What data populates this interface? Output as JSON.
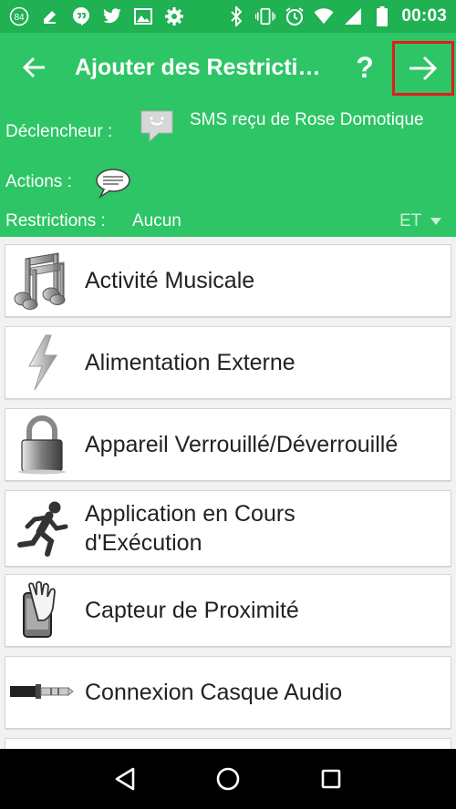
{
  "status_bar": {
    "notification_badge": "84",
    "time": "00:03",
    "icons_left": [
      "notification-84-icon",
      "hangouts-icon",
      "twitter-icon",
      "image-icon",
      "settings-icon"
    ],
    "icons_right": [
      "bluetooth-icon",
      "vibrate-icon",
      "alarm-icon",
      "wifi-icon",
      "signal-icon",
      "battery-icon"
    ]
  },
  "app_bar": {
    "title": "Ajouter des Restricti…",
    "help_label": "?",
    "background": "#2dc565",
    "highlight_color": "#e01d1d"
  },
  "summary": {
    "trigger_label": "Déclencheur :",
    "trigger_text": "SMS reçu de Rose Domotique",
    "actions_label": "Actions :",
    "restrictions_label": "Restrictions :",
    "restrictions_value": "Aucun",
    "logic_operator": "ET"
  },
  "list": {
    "items": [
      {
        "label": "Activité Musicale",
        "icon": "music-notes-icon"
      },
      {
        "label": "Alimentation Externe",
        "icon": "lightning-icon"
      },
      {
        "label": "Appareil Verrouillé/Déverrouillé",
        "icon": "padlock-icon"
      },
      {
        "label": "Application en Cours d'Exécution",
        "icon": "running-man-icon"
      },
      {
        "label": "Capteur de Proximité",
        "icon": "hand-phone-icon"
      },
      {
        "label": "Connexion Casque Audio",
        "icon": "audio-jack-icon"
      }
    ]
  },
  "nav_bar": {
    "buttons": [
      "back-nav-icon",
      "home-nav-icon",
      "recents-nav-icon"
    ]
  }
}
